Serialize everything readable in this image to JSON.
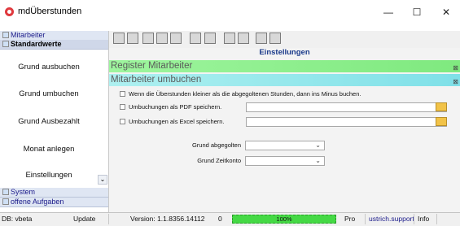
{
  "window": {
    "title": "mdÜberstunden",
    "minimize": "—",
    "maximize": "☐",
    "close": "✕"
  },
  "sidebar": {
    "top_headers": [
      {
        "label": "Mitarbeiter"
      },
      {
        "label": "Standardwerte"
      }
    ],
    "items": [
      {
        "label": "Grund ausbuchen"
      },
      {
        "label": "Grund umbuchen"
      },
      {
        "label": "Grund Ausbezahlt"
      },
      {
        "label": "Monat anlegen"
      },
      {
        "label": "Einstellungen"
      }
    ],
    "bottom_headers": [
      {
        "label": "System"
      },
      {
        "label": "offene Aufgaben"
      }
    ]
  },
  "main": {
    "title": "Einstellungen",
    "bar_register": "Register Mitarbeiter",
    "bar_umbuchen": "Mitarbeiter umbuchen",
    "options": [
      {
        "label": "Wenn die Überstunden kleiner als die abgegoltenen Stunden, dann ins Minus buchen."
      },
      {
        "label": "Umbuchungen als PDF speichern."
      },
      {
        "label": "Umbuchungen als Excel speichern."
      }
    ],
    "grund_abgegolten_label": "Grund abgegolten",
    "grund_zeitkonto_label": "Grund Zeitkonto"
  },
  "statusbar": {
    "db": "DB: vbeta",
    "update": "Update",
    "version": "Version: 1.1.8356.14112",
    "zero": "0",
    "progress_text": "100%",
    "progress_value": 1.0,
    "pro": "Pro",
    "support": "ustrich.support",
    "info": "Info"
  }
}
